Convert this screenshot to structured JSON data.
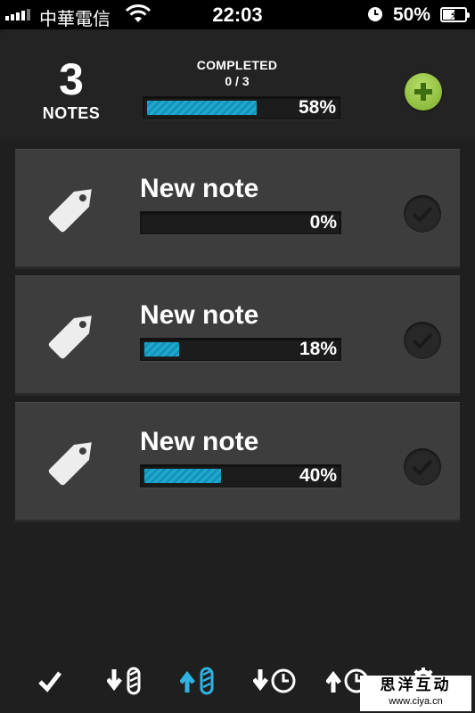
{
  "status_bar": {
    "carrier": "中華電信",
    "time": "22:03",
    "battery_percent": "50%"
  },
  "header": {
    "note_count": "3",
    "note_count_label": "NOTES",
    "completed_title": "COMPLETED",
    "completed_count": "0 / 3",
    "overall_progress": 58,
    "overall_progress_label": "58%"
  },
  "notes": [
    {
      "title": "New note",
      "progress": 0,
      "progress_label": "0%"
    },
    {
      "title": "New note",
      "progress": 18,
      "progress_label": "18%"
    },
    {
      "title": "New note",
      "progress": 40,
      "progress_label": "40%"
    }
  ],
  "toolbar": {
    "items": [
      {
        "icon": "checkmark-icon"
      },
      {
        "icon": "sort-down-progress-icon"
      },
      {
        "icon": "sort-up-progress-icon",
        "active": true
      },
      {
        "icon": "sort-down-time-icon"
      },
      {
        "icon": "sort-up-time-icon"
      },
      {
        "icon": "gear-icon"
      }
    ]
  },
  "watermark": {
    "text": "思洋互动",
    "url": "www.ciya.cn"
  },
  "colors": {
    "accent_blue": "#1fa9d1",
    "add_green": "#8fc33c",
    "card_gray": "#3d3d3d",
    "background": "#1f1f1f"
  }
}
